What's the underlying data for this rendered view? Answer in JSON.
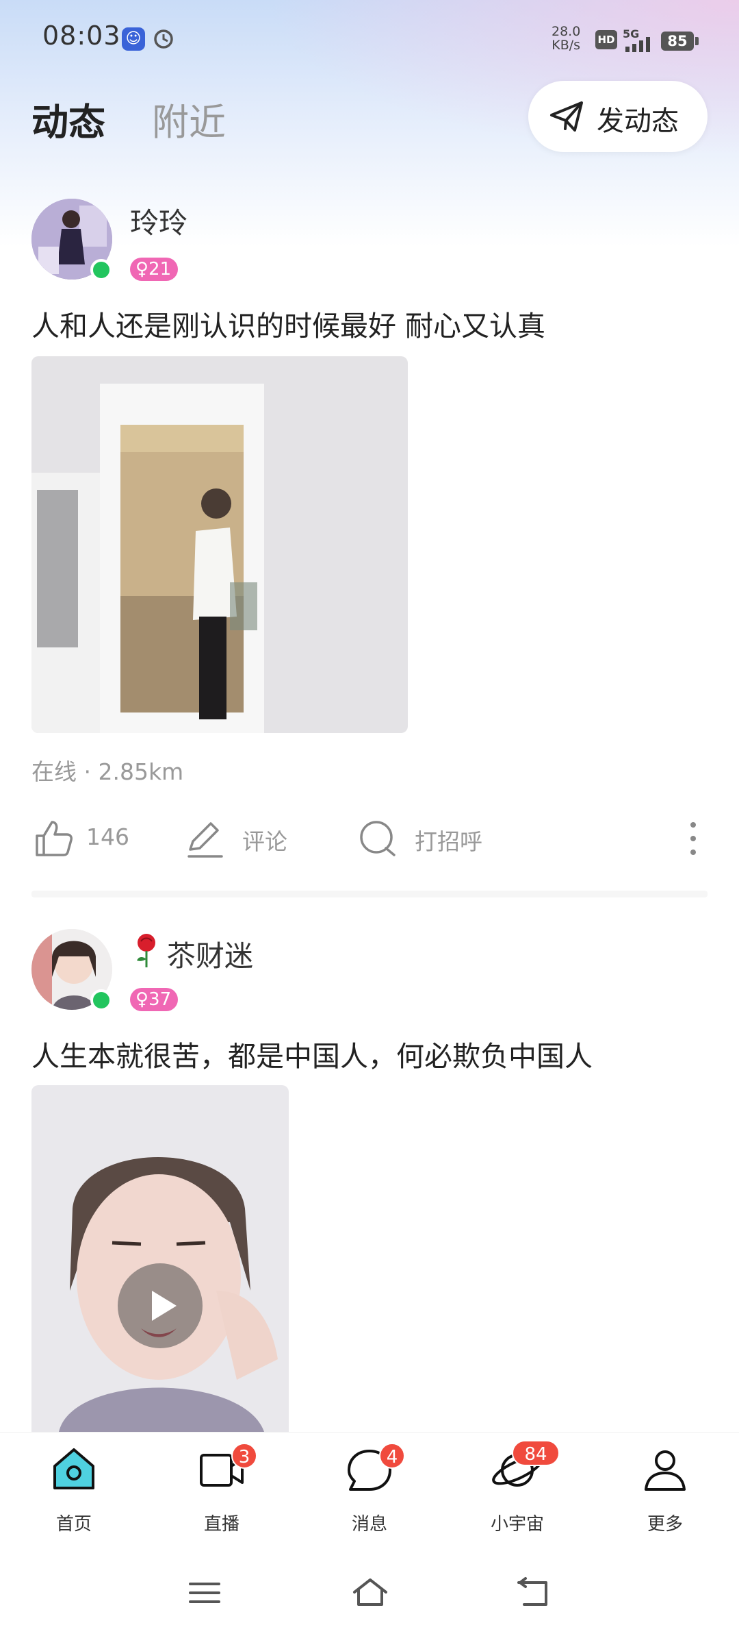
{
  "status_bar": {
    "time": "08:03",
    "speed_value": "28.0",
    "speed_unit": "KB/s",
    "hd": "HD",
    "network": "5G",
    "battery": "85"
  },
  "header": {
    "tabs": [
      {
        "label": "动态"
      },
      {
        "label": "附近"
      }
    ],
    "post_button_label": "发动态"
  },
  "posts": [
    {
      "username": "玲玲",
      "badge": "♀21",
      "text": "人和人还是刚认识的时候最好 耐心又认真",
      "meta": "在线 · 2.85km",
      "likes": "146",
      "comment_label": "评论",
      "greet_label": "打招呼"
    },
    {
      "username": "苶财迷",
      "badge": "♀37",
      "text": "人生本就很苦，都是中国人，何必欺负中国人"
    }
  ],
  "bottom_nav": [
    {
      "label": "首页"
    },
    {
      "label": "直播",
      "badge": "3"
    },
    {
      "label": "消息",
      "badge": "4"
    },
    {
      "label": "小宇宙",
      "badge": "84"
    },
    {
      "label": "更多"
    }
  ],
  "colors": {
    "accent": "#f067b4",
    "online": "#22c55e",
    "badge_red": "#f04a3d",
    "home_active": "#4fd1e0"
  }
}
